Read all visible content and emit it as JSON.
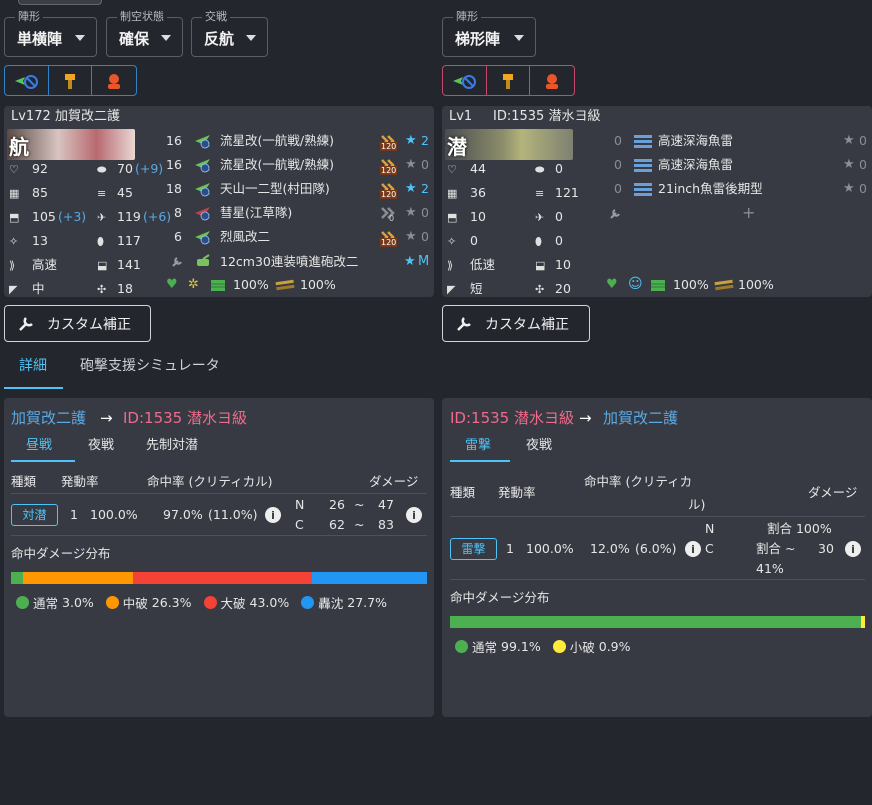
{
  "left_formation": {
    "formation_label": "陣形",
    "formation_value": "単横陣",
    "air_label": "制空状態",
    "air_value": "確保",
    "engagement_label": "交戦",
    "engagement_value": "反航"
  },
  "right_formation": {
    "formation_label": "陣形",
    "formation_value": "梯形陣"
  },
  "attacker": {
    "level": "Lv172",
    "name": "加賀改二護",
    "type_char": "航",
    "stats": [
      {
        "icon": "hp-icon",
        "value": "92",
        "extra": ""
      },
      {
        "icon": "armor-icon",
        "value": "70",
        "extra": "(+9)"
      },
      {
        "icon": "firepower-icon",
        "value": "85",
        "extra": ""
      },
      {
        "icon": "torpedo-icon",
        "value": "45",
        "extra": ""
      },
      {
        "icon": "aa-icon",
        "value": "105",
        "extra": "(+3)"
      },
      {
        "icon": "asw-icon",
        "value": "119",
        "extra": "(+6)"
      },
      {
        "icon": "evasion-icon",
        "value": "13",
        "extra": ""
      },
      {
        "icon": "ammo-icon",
        "value": "117",
        "extra": ""
      },
      {
        "icon": "speed-icon",
        "value": "高速",
        "extra": ""
      },
      {
        "icon": "los-icon",
        "value": "141",
        "extra": ""
      },
      {
        "icon": "range-icon",
        "value": "中",
        "extra": ""
      },
      {
        "icon": "luck-icon",
        "value": "18",
        "extra": ""
      }
    ],
    "equipment": [
      {
        "slot": "16",
        "name": "流星改(一航戦/熟練)",
        "prof": "120",
        "star": "2",
        "star_active": true
      },
      {
        "slot": "16",
        "name": "流星改(一航戦/熟練)",
        "prof": "120",
        "star": "0",
        "star_active": false
      },
      {
        "slot": "18",
        "name": "天山一二型(村田隊)",
        "prof": "120",
        "star": "2",
        "star_active": true
      },
      {
        "slot": "8",
        "name": "彗星(江草隊)",
        "prof": "0",
        "star": "0",
        "star_active": false
      },
      {
        "slot": "6",
        "name": "烈風改二",
        "prof": "120",
        "star": "0",
        "star_active": false
      }
    ],
    "ex_slot": {
      "name": "12cm30連装噴進砲改二",
      "star": "M"
    },
    "status": {
      "fuel": "100%",
      "ammo": "100%"
    }
  },
  "defender": {
    "level": "Lv1",
    "name": "ID:1535 潜水ヨ級",
    "type_char": "潜",
    "stats": [
      {
        "icon": "hp-icon",
        "value": "44"
      },
      {
        "icon": "armor-icon",
        "value": "0"
      },
      {
        "icon": "firepower-icon",
        "value": "36"
      },
      {
        "icon": "torpedo-icon",
        "value": "121"
      },
      {
        "icon": "aa-icon",
        "value": "10"
      },
      {
        "icon": "asw-icon",
        "value": "0"
      },
      {
        "icon": "evasion-icon",
        "value": "0"
      },
      {
        "icon": "ammo-icon",
        "value": "0"
      },
      {
        "icon": "speed-icon",
        "value": "低速"
      },
      {
        "icon": "los-icon",
        "value": "10"
      },
      {
        "icon": "range-icon",
        "value": "短"
      },
      {
        "icon": "luck-icon",
        "value": "20"
      }
    ],
    "equipment": [
      {
        "slot": "0",
        "name": "高速深海魚雷",
        "star": "0"
      },
      {
        "slot": "0",
        "name": "高速深海魚雷",
        "star": "0"
      },
      {
        "slot": "0",
        "name": "21inch魚雷後期型",
        "star": "0"
      }
    ],
    "status": {
      "fuel": "100%",
      "ammo": "100%"
    }
  },
  "custom_button_label": "カスタム補正",
  "tabs": {
    "detail": "詳細",
    "support": "砲撃支援シミュレータ"
  },
  "panel_left": {
    "from": "加賀改二護",
    "to": "ID:1535 潜水ヨ級",
    "tabs": [
      "昼戦",
      "夜戦",
      "先制対潜"
    ],
    "headers": {
      "type": "種類",
      "rate": "発動率",
      "hit": "命中率 (クリティカル)",
      "damage": "ダメージ"
    },
    "row": {
      "chip": "対潜",
      "count": "1",
      "rate": "100.0%",
      "hit": "97.0%",
      "crit": "(11.0%)",
      "n_label": "N",
      "n_min": "26",
      "n_max": "47",
      "c_label": "C",
      "c_min": "62",
      "c_max": "83",
      "tilde": "~"
    },
    "dist_title": "命中ダメージ分布",
    "dist": [
      {
        "label": "通常",
        "value": 3.0,
        "text": "3.0%",
        "color": "#4caf50"
      },
      {
        "label": "中破",
        "value": 26.3,
        "text": "26.3%",
        "color": "#ff9800"
      },
      {
        "label": "大破",
        "value": 43.0,
        "text": "43.0%",
        "color": "#f44336"
      },
      {
        "label": "轟沈",
        "value": 27.7,
        "text": "27.7%",
        "color": "#2196f3"
      }
    ]
  },
  "panel_right": {
    "from": "ID:1535 潜水ヨ級",
    "to": "加賀改二護",
    "tabs": [
      "雷撃",
      "夜戦"
    ],
    "headers": {
      "type": "種類",
      "rate": "発動率",
      "hit1": "命中率 (クリティカ",
      "hit2": "ル)",
      "damage": "ダメージ"
    },
    "row": {
      "chip": "雷撃",
      "count": "1",
      "rate": "100.0%",
      "hit": "12.0%",
      "crit": "(6.0%)",
      "n_label": "N",
      "n_dmg": "割合 100%",
      "c_label": "C",
      "c_dmg1": "割合 ~",
      "c_dmg_max": "30",
      "c_dmg2": "41%"
    },
    "dist_title": "命中ダメージ分布",
    "dist": [
      {
        "label": "通常",
        "value": 99.1,
        "text": "99.1%",
        "color": "#4caf50"
      },
      {
        "label": "小破",
        "value": 0.9,
        "text": "0.9%",
        "color": "#ffeb3b"
      }
    ]
  },
  "colors": {
    "accent": "#4fc3f7",
    "pink": "#f06b8b",
    "link_blue": "#5aa9e6"
  }
}
